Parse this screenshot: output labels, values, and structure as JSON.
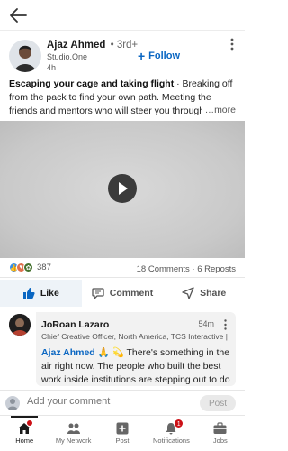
{
  "post": {
    "author": "Ajaz Ahmed",
    "degree": "• 3rd+",
    "company": "Studio.One",
    "time": "4h",
    "follow_label": "Follow",
    "text_bold": "Escaping your cage and taking flight",
    "text_rest": " · Breaking off from the pack to find your own path. Meeting the friends and mentors who will steer you through unknown terri",
    "more_label": "…more",
    "reaction_count": "387",
    "stats": "18 Comments · 6 Reposts"
  },
  "actions": {
    "like": "Like",
    "comment": "Comment",
    "share": "Share"
  },
  "comment": {
    "name": "JoRoan Lazaro",
    "time": "54m",
    "title": "Chief Creative Officer, North America, TCS Interactive | …",
    "mention": "Ajaz Ahmed",
    "emojis": " 🙏 💫 ",
    "text": "There's something in the air right now. The people who built the best work inside institutions are stepping out to do it"
  },
  "composer": {
    "placeholder": "Add your comment",
    "post_label": "Post"
  },
  "nav": {
    "home": "Home",
    "network": "My Network",
    "post": "Post",
    "notifications": "Notifications",
    "notifications_count": "1",
    "jobs": "Jobs"
  },
  "colors": {
    "brand_blue": "#0a66c2",
    "badge_red": "#cc1016"
  }
}
